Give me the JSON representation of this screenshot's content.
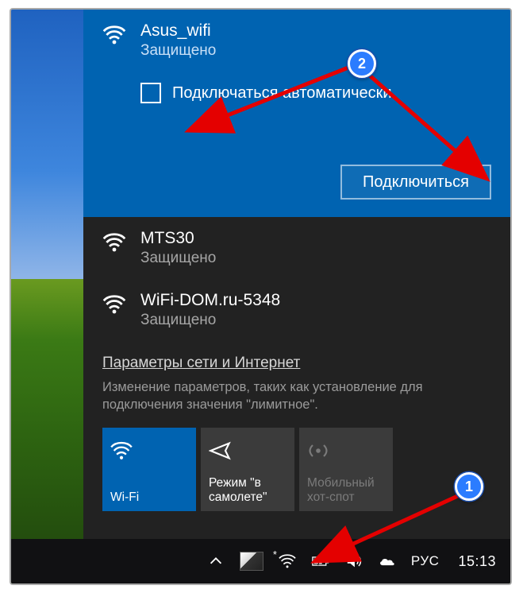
{
  "selected_network": {
    "name": "Asus_wifi",
    "status": "Защищено",
    "auto_connect_label": "Подключаться автоматически",
    "connect_label": "Подключиться"
  },
  "other_networks": [
    {
      "name": "MTS30",
      "status": "Защищено"
    },
    {
      "name": "WiFi-DOM.ru-5348",
      "status": "Защищено"
    }
  ],
  "footer": {
    "link": "Параметры сети и Интернет",
    "description": "Изменение параметров, таких как установление для подключения значения \"лимитное\"."
  },
  "tiles": {
    "wifi": "Wi-Fi",
    "airplane": "Режим \"в самолете\"",
    "hotspot": "Мобильный хот-спот"
  },
  "taskbar": {
    "lang": "РУС",
    "clock": "15:13"
  },
  "callouts": {
    "one": "1",
    "two": "2"
  }
}
